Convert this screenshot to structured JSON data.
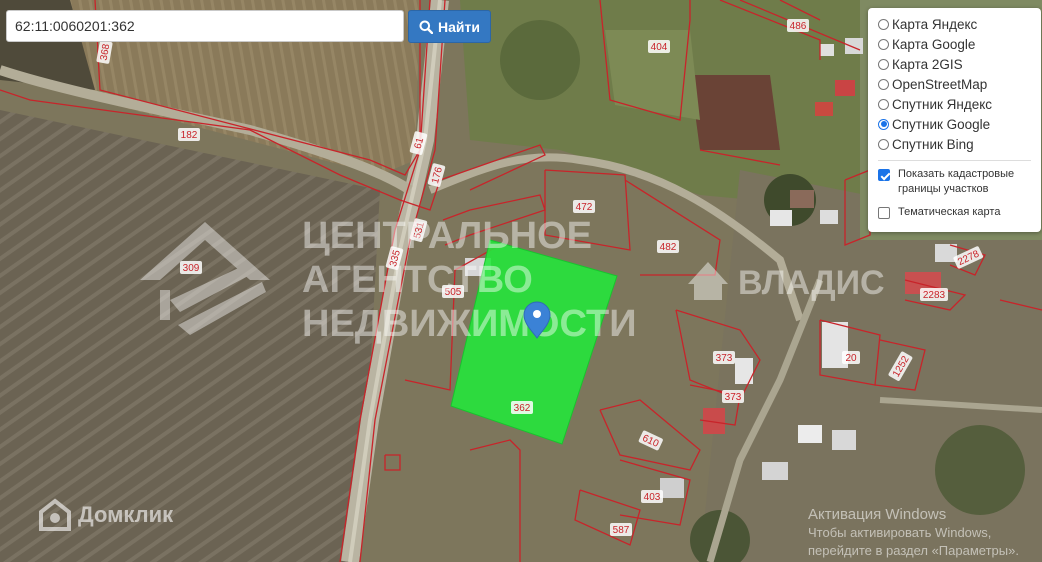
{
  "search": {
    "value": "62:11:0060201:362",
    "button_label": "Найти"
  },
  "layers": {
    "options": [
      {
        "label": "Карта Яндекс",
        "checked": false
      },
      {
        "label": "Карта Google",
        "checked": false
      },
      {
        "label": "Карта 2GIS",
        "checked": false
      },
      {
        "label": "OpenStreetMap",
        "checked": false
      },
      {
        "label": "Спутник Яндекс",
        "checked": false
      },
      {
        "label": "Спутник Google",
        "checked": true
      },
      {
        "label": "Спутник Bing",
        "checked": false
      }
    ],
    "show_cadastral": {
      "label": "Показать кадастровые границы участков",
      "checked": true
    },
    "thematic": {
      "label": "Тематическая карта",
      "checked": false
    }
  },
  "map": {
    "parcel_labels": [
      "362",
      "505",
      "472",
      "482",
      "404",
      "486",
      "182",
      "61",
      "176",
      "531",
      "335",
      "309",
      "368",
      "373",
      "373",
      "610",
      "403",
      "587",
      "20",
      "1252",
      "2278",
      "2283"
    ],
    "watermark_agency": [
      "ЦЕНТРАЛЬНОЕ",
      "АГЕНТСТВО",
      "НЕДВИЖИМОСТИ"
    ],
    "watermark_vladis": "ВЛАДИС",
    "watermark_domclick": "Домклик",
    "windows_activation": [
      "Активация Windows",
      "Чтобы активировать Windows,",
      "перейдите в раздел «Параметры»."
    ]
  },
  "colors": {
    "cadastral_line": "#c8242a",
    "selected_parcel": "#22e83a",
    "button": "#3478c2",
    "marker": "#3b82d6"
  }
}
